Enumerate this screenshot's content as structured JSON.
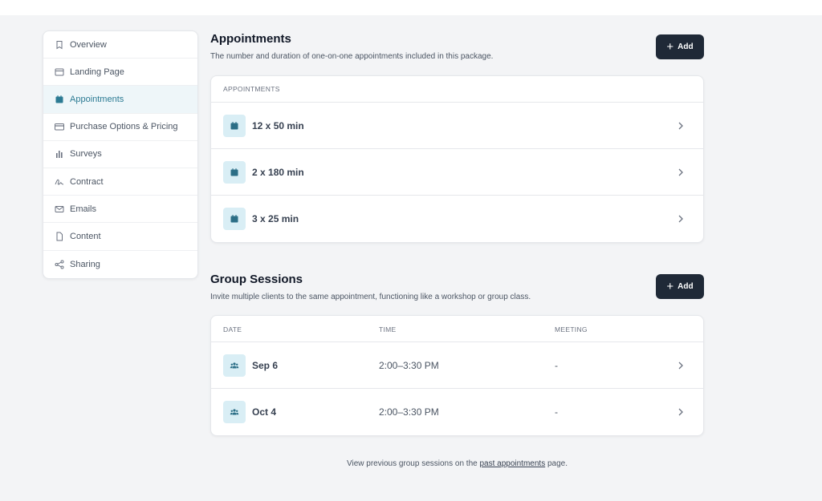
{
  "sidebar": {
    "items": [
      {
        "label": "Overview",
        "icon": "bookmark-icon",
        "active": false
      },
      {
        "label": "Landing Page",
        "icon": "browser-window-icon",
        "active": false
      },
      {
        "label": "Appointments",
        "icon": "calendar-icon",
        "active": true
      },
      {
        "label": "Purchase Options & Pricing",
        "icon": "credit-card-icon",
        "active": false
      },
      {
        "label": "Surveys",
        "icon": "bar-chart-icon",
        "active": false
      },
      {
        "label": "Contract",
        "icon": "signature-icon",
        "active": false
      },
      {
        "label": "Emails",
        "icon": "mail-icon",
        "active": false
      },
      {
        "label": "Content",
        "icon": "document-icon",
        "active": false
      },
      {
        "label": "Sharing",
        "icon": "share-icon",
        "active": false
      }
    ]
  },
  "appointments": {
    "title": "Appointments",
    "description": "The number and duration of one-on-one appointments included in this package.",
    "add_label": "Add",
    "header": "APPOINTMENTS",
    "rows": [
      {
        "label": "12 x 50 min"
      },
      {
        "label": "2 x 180 min"
      },
      {
        "label": "3 x 25 min"
      }
    ]
  },
  "group_sessions": {
    "title": "Group Sessions",
    "description": "Invite multiple clients to the same appointment, functioning like a workshop or group class.",
    "add_label": "Add",
    "headers": {
      "date": "DATE",
      "time": "TIME",
      "meeting": "MEETING"
    },
    "rows": [
      {
        "date": "Sep 6",
        "time": "2:00–3:30 PM",
        "meeting": "-"
      },
      {
        "date": "Oct 4",
        "time": "2:00–3:30 PM",
        "meeting": "-"
      }
    ]
  },
  "footer": {
    "prefix": "View previous group sessions on the ",
    "link": "past appointments",
    "suffix": " page."
  },
  "colors": {
    "accent": "#2b7a93",
    "button": "#1f2937",
    "icon_bg": "#d9eef5"
  }
}
